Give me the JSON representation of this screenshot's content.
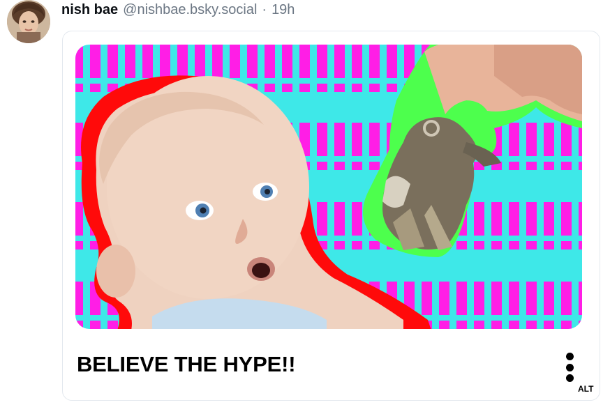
{
  "post": {
    "display_name": "nish bae",
    "handle": "@nishbae.bsky.social",
    "separator": "·",
    "timestamp": "19h"
  },
  "embed": {
    "caption": "BELIEVE THE HYPE!!",
    "alt_badge": "ALT"
  },
  "icons": {
    "avatar": "user-avatar-photo",
    "more": "vertical-dots-icon"
  },
  "colors": {
    "stripe_magenta": "#ff1ee6",
    "stripe_cyan": "#3ee8e8",
    "outline_red": "#ff0a0a",
    "outline_green": "#4dff4d"
  }
}
